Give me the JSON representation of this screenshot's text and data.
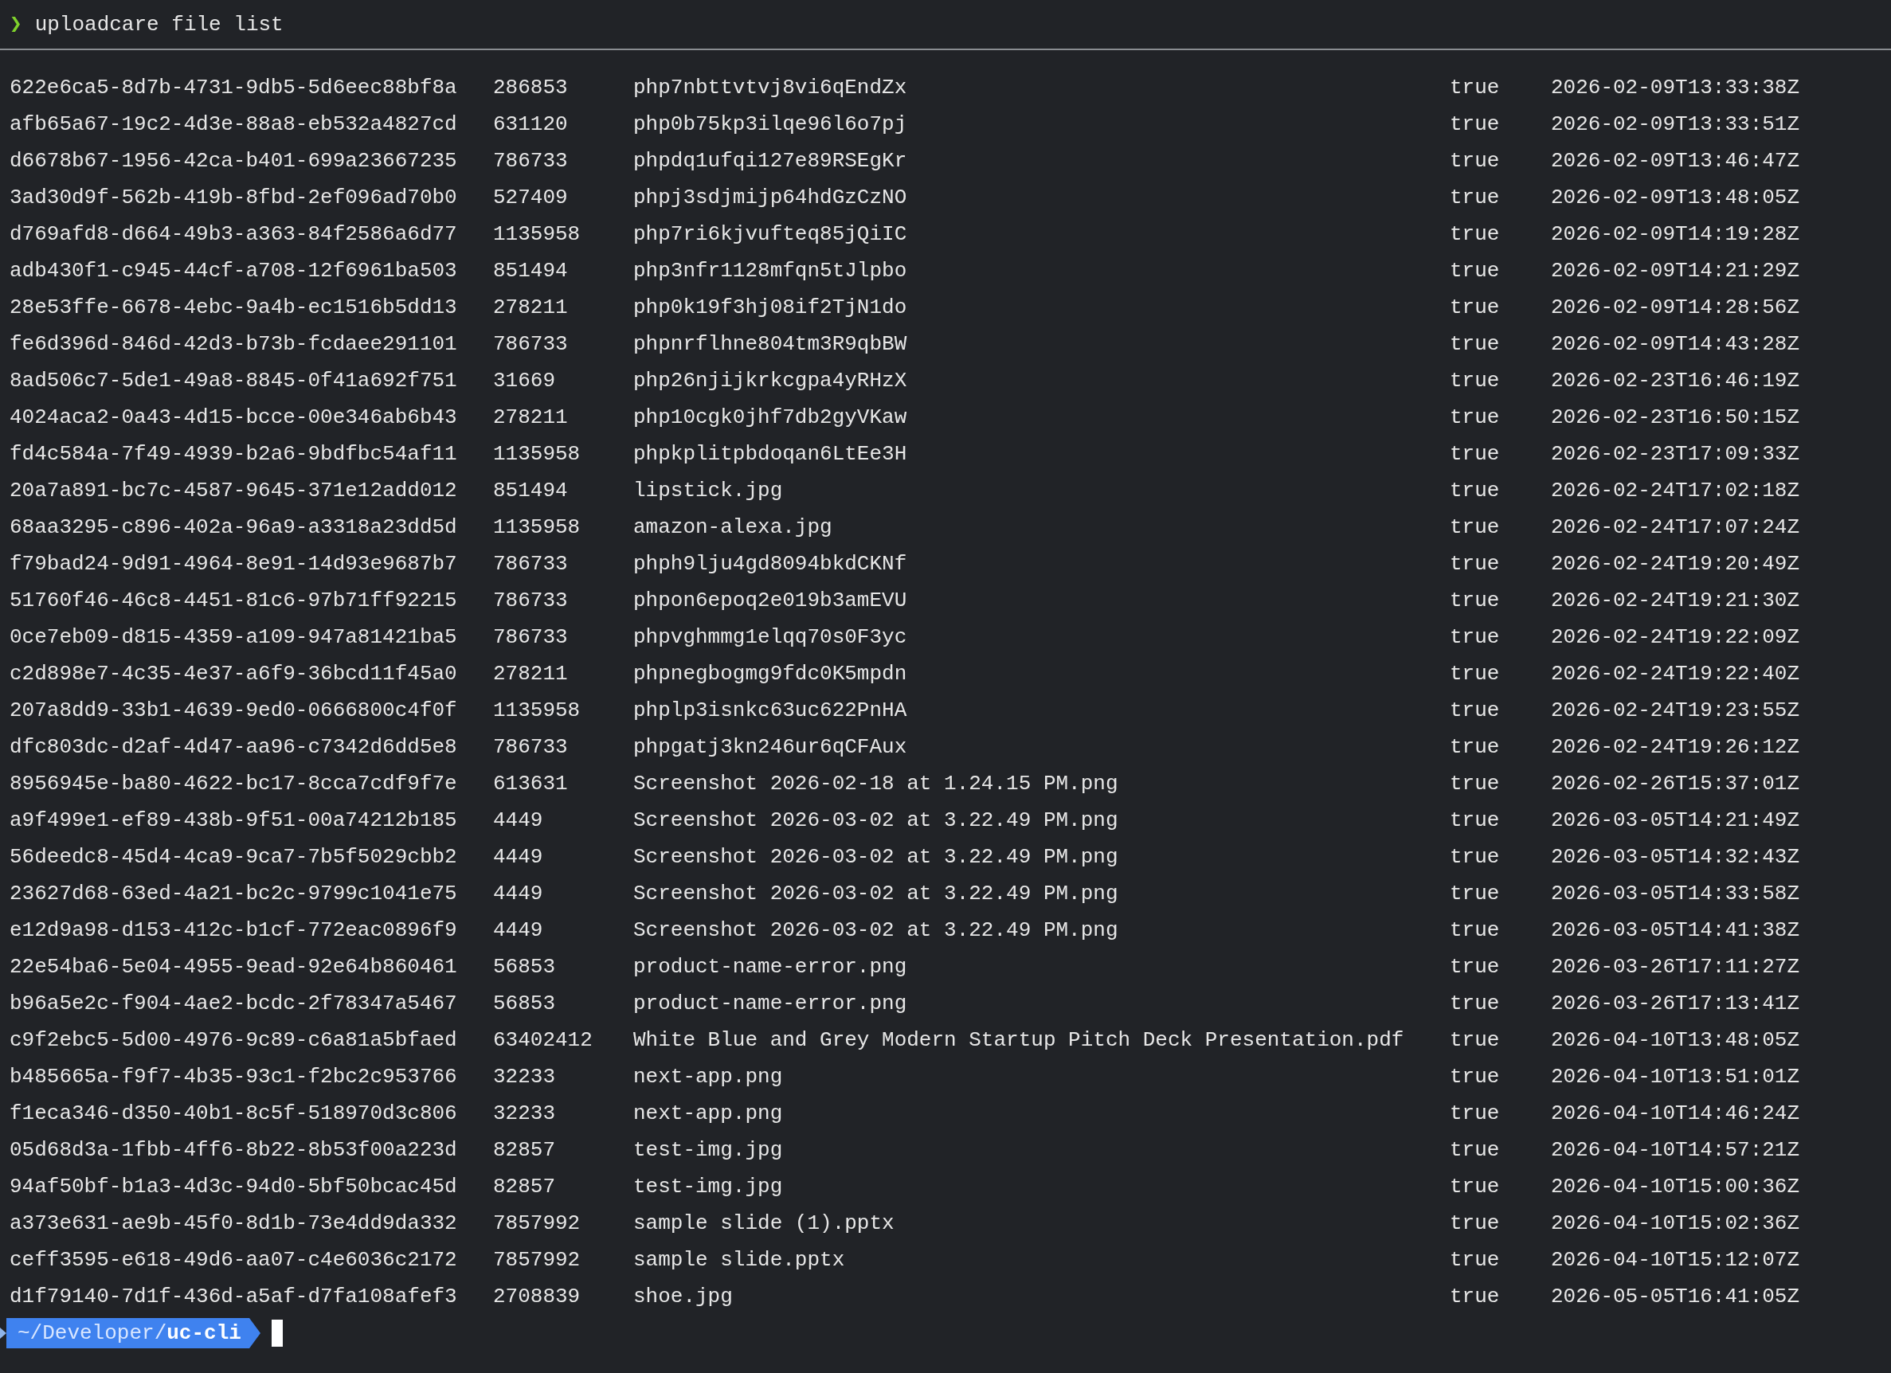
{
  "header": {
    "prompt_symbol": "❯",
    "command": "uploadcare file list"
  },
  "table": {
    "rows": [
      [
        "622e6ca5-8d7b-4731-9db5-5d6eec88bf8a",
        "286853",
        "php7nbttvtvj8vi6qEndZx",
        "true",
        "2026-02-09T13:33:38Z"
      ],
      [
        "afb65a67-19c2-4d3e-88a8-eb532a4827cd",
        "631120",
        "php0b75kp3ilqe96l6o7pj",
        "true",
        "2026-02-09T13:33:51Z"
      ],
      [
        "d6678b67-1956-42ca-b401-699a23667235",
        "786733",
        "phpdq1ufqi127e89RSEgKr",
        "true",
        "2026-02-09T13:46:47Z"
      ],
      [
        "3ad30d9f-562b-419b-8fbd-2ef096ad70b0",
        "527409",
        "phpj3sdjmijp64hdGzCzNO",
        "true",
        "2026-02-09T13:48:05Z"
      ],
      [
        "d769afd8-d664-49b3-a363-84f2586a6d77",
        "1135958",
        "php7ri6kjvufteq85jQiIC",
        "true",
        "2026-02-09T14:19:28Z"
      ],
      [
        "adb430f1-c945-44cf-a708-12f6961ba503",
        "851494",
        "php3nfr1128mfqn5tJlpbo",
        "true",
        "2026-02-09T14:21:29Z"
      ],
      [
        "28e53ffe-6678-4ebc-9a4b-ec1516b5dd13",
        "278211",
        "php0k19f3hj08if2TjN1do",
        "true",
        "2026-02-09T14:28:56Z"
      ],
      [
        "fe6d396d-846d-42d3-b73b-fcdaee291101",
        "786733",
        "phpnrflhne804tm3R9qbBW",
        "true",
        "2026-02-09T14:43:28Z"
      ],
      [
        "8ad506c7-5de1-49a8-8845-0f41a692f751",
        "31669",
        "php26njijkrkcgpa4yRHzX",
        "true",
        "2026-02-23T16:46:19Z"
      ],
      [
        "4024aca2-0a43-4d15-bcce-00e346ab6b43",
        "278211",
        "php10cgk0jhf7db2gyVKaw",
        "true",
        "2026-02-23T16:50:15Z"
      ],
      [
        "fd4c584a-7f49-4939-b2a6-9bdfbc54af11",
        "1135958",
        "phpkplitpbdoqan6LtEe3H",
        "true",
        "2026-02-23T17:09:33Z"
      ],
      [
        "20a7a891-bc7c-4587-9645-371e12add012",
        "851494",
        "lipstick.jpg",
        "true",
        "2026-02-24T17:02:18Z"
      ],
      [
        "68aa3295-c896-402a-96a9-a3318a23dd5d",
        "1135958",
        "amazon-alexa.jpg",
        "true",
        "2026-02-24T17:07:24Z"
      ],
      [
        "f79bad24-9d91-4964-8e91-14d93e9687b7",
        "786733",
        "phph9lju4gd8094bkdCKNf",
        "true",
        "2026-02-24T19:20:49Z"
      ],
      [
        "51760f46-46c8-4451-81c6-97b71ff92215",
        "786733",
        "phpon6epoq2e019b3amEVU",
        "true",
        "2026-02-24T19:21:30Z"
      ],
      [
        "0ce7eb09-d815-4359-a109-947a81421ba5",
        "786733",
        "phpvghmmg1elqq70s0F3yc",
        "true",
        "2026-02-24T19:22:09Z"
      ],
      [
        "c2d898e7-4c35-4e37-a6f9-36bcd11f45a0",
        "278211",
        "phpnegbogmg9fdc0K5mpdn",
        "true",
        "2026-02-24T19:22:40Z"
      ],
      [
        "207a8dd9-33b1-4639-9ed0-0666800c4f0f",
        "1135958",
        "phplp3isnkc63uc622PnHA",
        "true",
        "2026-02-24T19:23:55Z"
      ],
      [
        "dfc803dc-d2af-4d47-aa96-c7342d6dd5e8",
        "786733",
        "phpgatj3kn246ur6qCFAux",
        "true",
        "2026-02-24T19:26:12Z"
      ],
      [
        "8956945e-ba80-4622-bc17-8cca7cdf9f7e",
        "613631",
        "Screenshot 2026-02-18 at 1.24.15 PM.png",
        "true",
        "2026-02-26T15:37:01Z"
      ],
      [
        "a9f499e1-ef89-438b-9f51-00a74212b185",
        "4449",
        "Screenshot 2026-03-02 at 3.22.49 PM.png",
        "true",
        "2026-03-05T14:21:49Z"
      ],
      [
        "56deedc8-45d4-4ca9-9ca7-7b5f5029cbb2",
        "4449",
        "Screenshot 2026-03-02 at 3.22.49 PM.png",
        "true",
        "2026-03-05T14:32:43Z"
      ],
      [
        "23627d68-63ed-4a21-bc2c-9799c1041e75",
        "4449",
        "Screenshot 2026-03-02 at 3.22.49 PM.png",
        "true",
        "2026-03-05T14:33:58Z"
      ],
      [
        "e12d9a98-d153-412c-b1cf-772eac0896f9",
        "4449",
        "Screenshot 2026-03-02 at 3.22.49 PM.png",
        "true",
        "2026-03-05T14:41:38Z"
      ],
      [
        "22e54ba6-5e04-4955-9ead-92e64b860461",
        "56853",
        "product-name-error.png",
        "true",
        "2026-03-26T17:11:27Z"
      ],
      [
        "b96a5e2c-f904-4ae2-bcdc-2f78347a5467",
        "56853",
        "product-name-error.png",
        "true",
        "2026-03-26T17:13:41Z"
      ],
      [
        "c9f2ebc5-5d00-4976-9c89-c6a81a5bfaed",
        "63402412",
        "White Blue and Grey Modern Startup Pitch Deck Presentation.pdf",
        "true",
        "2026-04-10T13:48:05Z"
      ],
      [
        "b485665a-f9f7-4b35-93c1-f2bc2c953766",
        "32233",
        "next-app.png",
        "true",
        "2026-04-10T13:51:01Z"
      ],
      [
        "f1eca346-d350-40b1-8c5f-518970d3c806",
        "32233",
        "next-app.png",
        "true",
        "2026-04-10T14:46:24Z"
      ],
      [
        "05d68d3a-1fbb-4ff6-8b22-8b53f00a223d",
        "82857",
        "test-img.jpg",
        "true",
        "2026-04-10T14:57:21Z"
      ],
      [
        "94af50bf-b1a3-4d3c-94d0-5bf50bcac45d",
        "82857",
        "test-img.jpg",
        "true",
        "2026-04-10T15:00:36Z"
      ],
      [
        "a373e631-ae9b-45f0-8d1b-73e4dd9da332",
        "7857992",
        "sample slide (1).pptx",
        "true",
        "2026-04-10T15:02:36Z"
      ],
      [
        "ceff3595-e618-49d6-aa07-c4e6036c2172",
        "7857992",
        "sample slide.pptx",
        "true",
        "2026-04-10T15:12:07Z"
      ],
      [
        "d1f79140-7d1f-436d-a5af-d7fa108afef3",
        "2708839",
        "shoe.jpg",
        "true",
        "2026-05-05T16:41:05Z"
      ]
    ]
  },
  "prompt": {
    "path": "~/Developer/",
    "directory": "uc-cli"
  }
}
